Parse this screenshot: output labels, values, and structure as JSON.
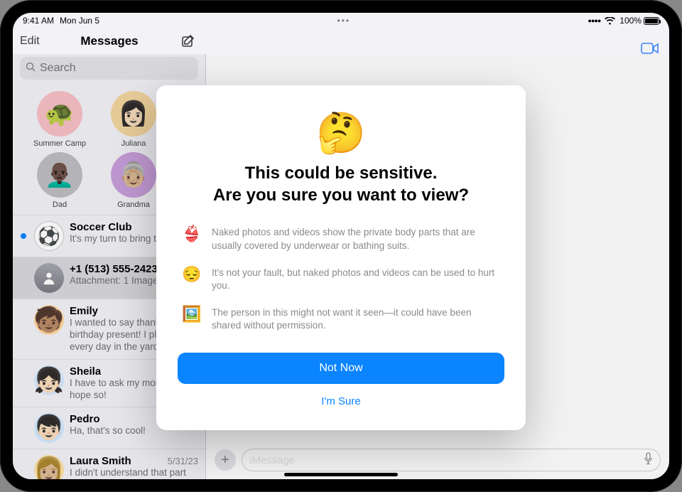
{
  "status": {
    "time": "9:41 AM",
    "date": "Mon Jun 5",
    "battery_pct": "100%"
  },
  "nav": {
    "edit": "Edit",
    "title": "Messages"
  },
  "search": {
    "placeholder": "Search"
  },
  "pins": [
    {
      "label": "Summer Camp",
      "emoji": "🐢",
      "bg": "#f7bfc6"
    },
    {
      "label": "Juliana",
      "emoji": "👩🏻",
      "bg": "#f4d6a0"
    },
    {
      "label": "Dad",
      "emoji": "👨🏿‍🦲",
      "bg": "#bdbdc2"
    },
    {
      "label": "Grandma",
      "emoji": "👵🏼",
      "bg": "#c9a0dc"
    }
  ],
  "conversations": [
    {
      "name": "Soccer Club",
      "preview": "It's my turn to bring the snack!",
      "time": "",
      "unread": true,
      "avatar": "⚽",
      "bg": "#ffffff",
      "selected": false
    },
    {
      "name": "+1 (513) 555-2423",
      "preview": "Attachment: 1 Image",
      "time": "",
      "unread": false,
      "avatar": "person",
      "bg": "",
      "selected": true
    },
    {
      "name": "Emily",
      "preview": "I wanted to say thanks for the birthday present! I play with it every day in the yard!",
      "time": "",
      "unread": false,
      "avatar": "🧒🏽",
      "bg": "#ffd69e",
      "selected": false
    },
    {
      "name": "Sheila",
      "preview": "I have to ask my mom but I hope so!",
      "time": "",
      "unread": false,
      "avatar": "👧🏻",
      "bg": "#d6e9ff",
      "selected": false
    },
    {
      "name": "Pedro",
      "preview": "Ha, that's so cool!",
      "time": "",
      "unread": false,
      "avatar": "👦🏻",
      "bg": "#cfe8ff",
      "selected": false
    },
    {
      "name": "Laura Smith",
      "preview": "I didn't understand that part either.",
      "time": "5/31/23",
      "unread": false,
      "avatar": "👩🏼",
      "bg": "#ffe0a3",
      "selected": false
    }
  ],
  "modal": {
    "emoji": "🤔",
    "title_line1": "This could be sensitive.",
    "title_line2": "Are you sure you want to view?",
    "bullets": [
      {
        "icon": "👙",
        "text": "Naked photos and videos show the private body parts that are usually covered by underwear or bathing suits."
      },
      {
        "icon": "😔",
        "text": "It's not your fault, but naked photos and videos can be used to hurt you."
      },
      {
        "icon": "🖼️",
        "text": "The person in this might not want it seen—it could have been shared without permission."
      }
    ],
    "primary": "Not Now",
    "secondary": "I'm Sure"
  },
  "compose": {
    "placeholder": "iMessage"
  }
}
